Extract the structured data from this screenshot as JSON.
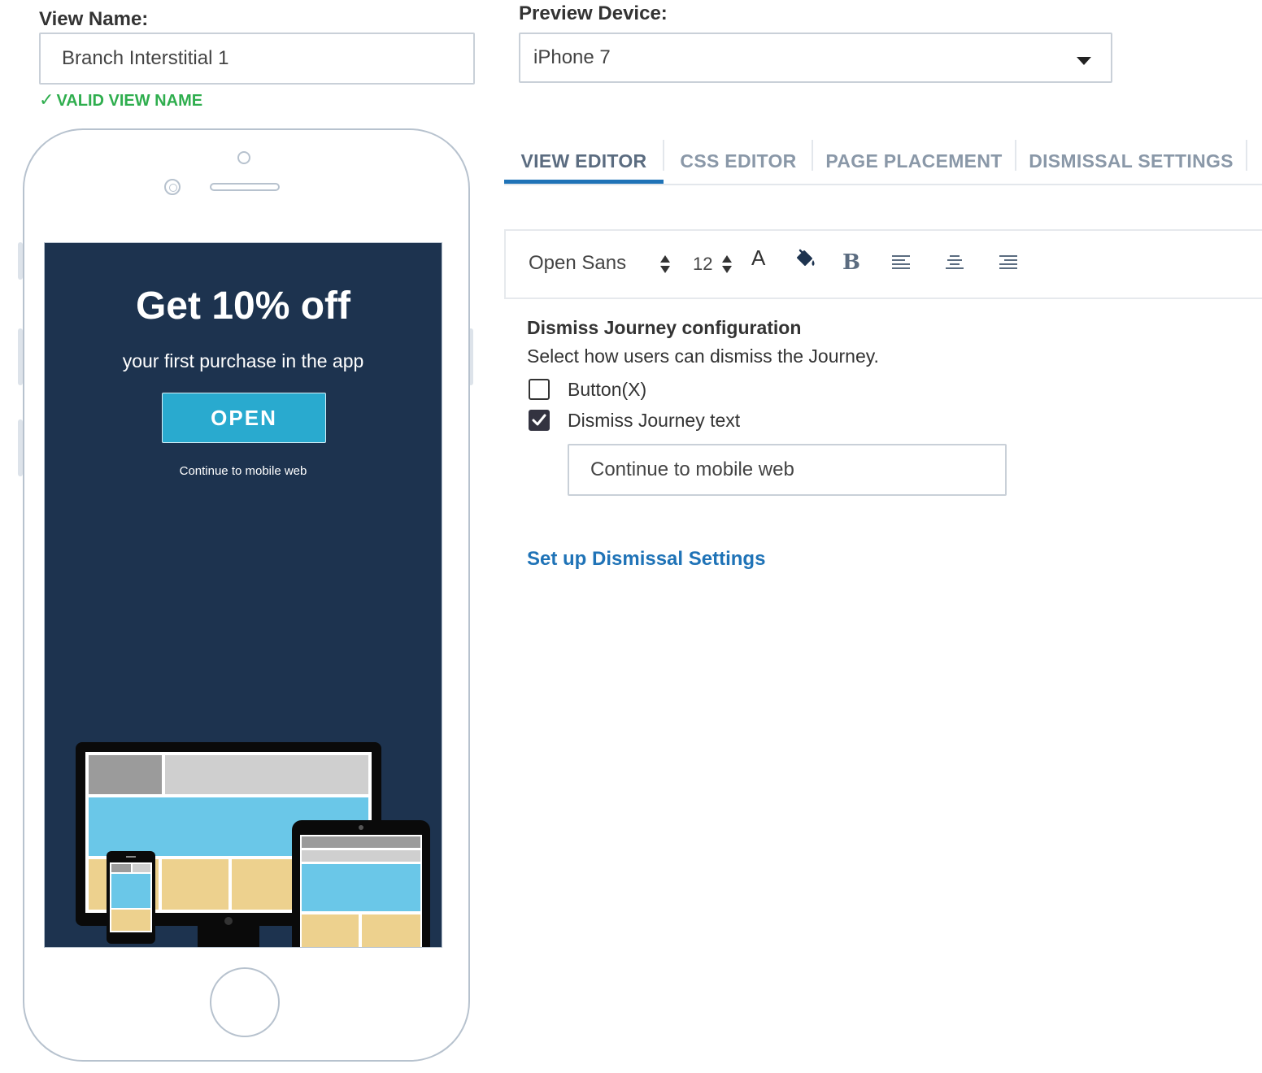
{
  "view_name": {
    "label": "View Name:",
    "value": "Branch Interstitial 1",
    "validation": "VALID VIEW NAME",
    "validation_color": "#2fae4e"
  },
  "preview_device": {
    "label": "Preview Device:",
    "selected": "iPhone 7"
  },
  "phone_preview": {
    "headline": "Get 10% off",
    "subheadline": "your first purchase in the app",
    "button_label": "OPEN",
    "dismiss_text": "Continue to mobile web",
    "background_color": "#1d334f",
    "button_color": "#29aacf"
  },
  "tabs": [
    {
      "label": "VIEW EDITOR",
      "active": true
    },
    {
      "label": "CSS EDITOR",
      "active": false
    },
    {
      "label": "PAGE PLACEMENT",
      "active": false
    },
    {
      "label": "DISMISSAL SETTINGS",
      "active": false
    }
  ],
  "toolbar": {
    "font_family": "Open Sans",
    "font_size": "12",
    "text_color_glyph": "A",
    "bold_glyph": "B",
    "icons": [
      "font-color-icon",
      "fill-color-icon",
      "bold-icon",
      "align-left-icon",
      "align-center-icon",
      "align-right-icon"
    ]
  },
  "dismiss_config": {
    "title": "Dismiss Journey configuration",
    "description": "Select how users can dismiss the Journey.",
    "options": [
      {
        "label": "Button(X)",
        "checked": false
      },
      {
        "label": "Dismiss Journey text",
        "checked": true
      }
    ],
    "text_value": "Continue to mobile web"
  },
  "setup_link": "Set up Dismissal Settings",
  "accent_color": "#1f73b7"
}
